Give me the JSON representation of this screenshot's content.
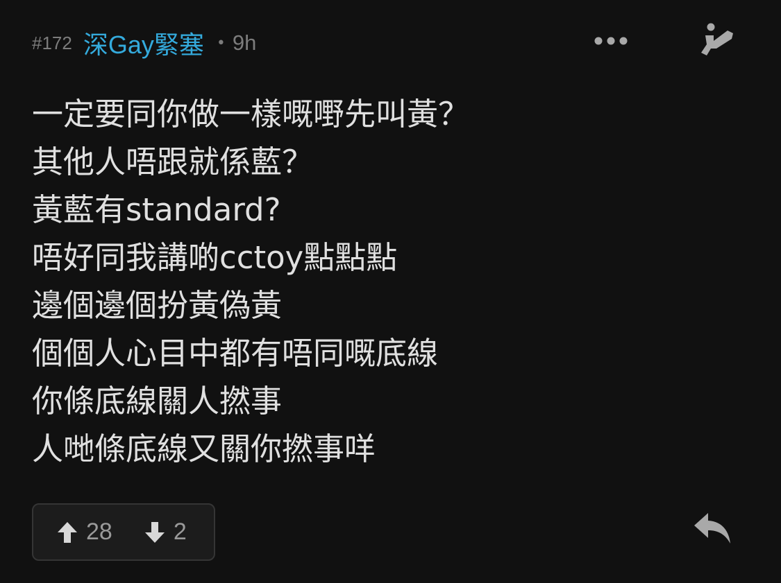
{
  "post": {
    "number": "#172",
    "username": "深Gay緊塞",
    "separator": "•",
    "time": "9h",
    "lines": [
      "一定要同你做一樣嘅嘢先叫黃？",
      "其他人唔跟就係藍？",
      "黃藍有standard?",
      "唔好同我講啲cctoy點點點",
      "邊個邊個扮黃偽黃",
      "個個人心目中都有唔同嘅底線",
      "你條底線關人撚事",
      "人哋條底線又關你撚事咩"
    ]
  },
  "votes": {
    "up_count": "28",
    "down_count": "2"
  },
  "icons": {
    "more": "more-horizontal-icon",
    "quote": "quote-icon",
    "upvote": "arrow-up-icon",
    "downvote": "arrow-down-icon",
    "reply": "reply-icon"
  },
  "colors": {
    "background": "#111111",
    "username": "#34aadc",
    "meta": "#7c7c7c",
    "body_text": "#e0e0e0",
    "vote_box_bg": "#1c1c1c",
    "vote_box_border": "#353535"
  }
}
